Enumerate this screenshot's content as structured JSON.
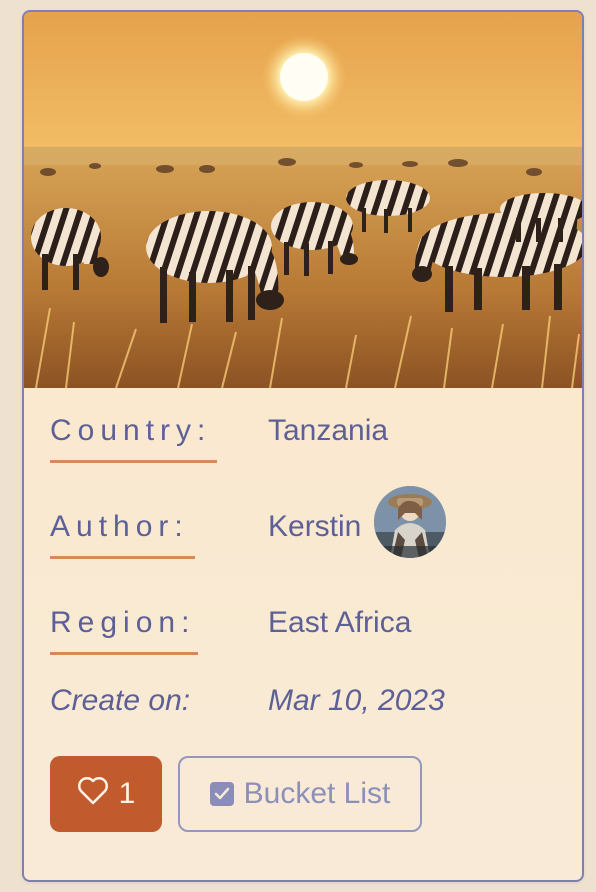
{
  "card": {
    "hero_image_alt": "zebras grazing at sunset",
    "fields": [
      {
        "label": "Country:",
        "value": "Tanzania"
      },
      {
        "label": "Author:",
        "value": "Kerstin"
      },
      {
        "label": "Region:",
        "value": "East Africa"
      }
    ],
    "created": {
      "label": "Create on:",
      "value": "Mar 10, 2023"
    },
    "actions": {
      "like_count": "1",
      "bucket_list_label": "Bucket List"
    },
    "icons": {
      "like": "heart-icon",
      "bucket_list": "checkbox-icon"
    },
    "colors": {
      "accent": "#c15a2d",
      "text": "#5d5f97",
      "underline": "#d48b57",
      "border": "#7d80b0"
    }
  }
}
